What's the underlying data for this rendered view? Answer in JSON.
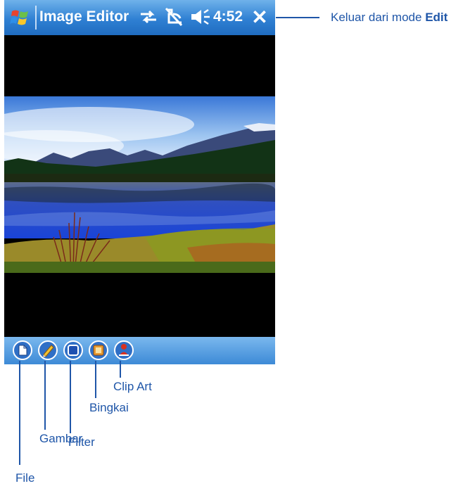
{
  "titlebar": {
    "title": "Image Editor",
    "time": "4:52",
    "close_symbol": "✕"
  },
  "toolbar": {
    "icons": [
      "file-icon",
      "draw-icon",
      "filter-icon",
      "frame-icon",
      "clip-art-icon"
    ]
  },
  "callouts": {
    "exit_edit_prefix": "Keluar dari mode",
    "exit_edit_bold": "Edit",
    "file": "File",
    "draw": "Gambar",
    "filter": "Filter",
    "frame": "Bingkai",
    "clip_art": "Clip Art"
  },
  "colors": {
    "accent_blue": "#2f80d3",
    "callout_text": "#1f56a8"
  }
}
